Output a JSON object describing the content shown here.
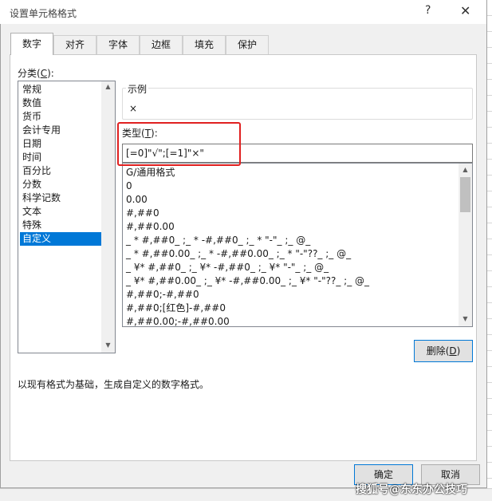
{
  "dialog": {
    "title": "设置单元格格式",
    "help": "?",
    "close": "✕"
  },
  "tabs": [
    {
      "label": "数字",
      "active": true
    },
    {
      "label": "对齐"
    },
    {
      "label": "字体"
    },
    {
      "label": "边框"
    },
    {
      "label": "填充"
    },
    {
      "label": "保护"
    }
  ],
  "category": {
    "label_prefix": "分类(",
    "label_key": "C",
    "label_suffix": "):",
    "items": [
      "常规",
      "数值",
      "货币",
      "会计专用",
      "日期",
      "时间",
      "百分比",
      "分数",
      "科学记数",
      "文本",
      "特殊",
      "自定义"
    ],
    "selected": "自定义"
  },
  "sample": {
    "label": "示例",
    "value": "×"
  },
  "type": {
    "label_prefix": "类型(",
    "label_key": "T",
    "label_suffix": "):",
    "value": "[=0]\"√\";[=1]\"×\""
  },
  "formats": [
    "G/通用格式",
    "0",
    "0.00",
    "#,##0",
    "#,##0.00",
    "_ * #,##0_ ;_ * -#,##0_ ;_ * \"-\"_ ;_ @_",
    "_ * #,##0.00_ ;_ * -#,##0.00_ ;_ * \"-\"??_ ;_ @_",
    "_ ¥* #,##0_ ;_ ¥* -#,##0_ ;_ ¥* \"-\"_ ;_ @_",
    "_ ¥* #,##0.00_ ;_ ¥* -#,##0.00_ ;_ ¥* \"-\"??_ ;_ @_",
    "#,##0;-#,##0",
    "#,##0;[红色]-#,##0",
    "#,##0.00;-#,##0.00"
  ],
  "delete_button": {
    "prefix": "删除(",
    "key": "D",
    "suffix": ")"
  },
  "description": "以现有格式为基础，生成自定义的数字格式。",
  "ok_button": "确定",
  "cancel_button": "取消",
  "watermark": "搜狐号@东东办公技巧",
  "colors": {
    "accent": "#0078d7",
    "highlight_box": "#e02020"
  }
}
